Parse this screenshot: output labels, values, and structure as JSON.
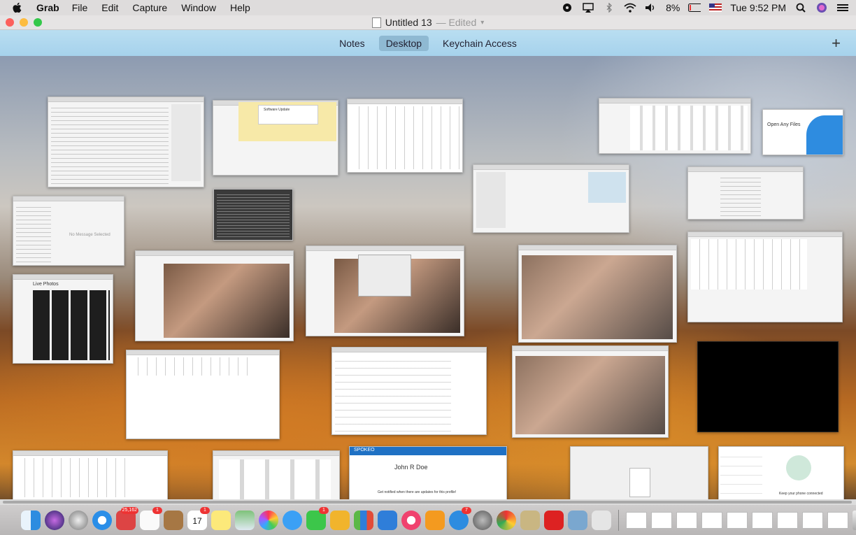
{
  "menubar": {
    "app_name": "Grab",
    "menus": [
      "File",
      "Edit",
      "Capture",
      "Window",
      "Help"
    ],
    "battery": "8%",
    "clock": "Tue 9:52 PM"
  },
  "window": {
    "title": "Untitled 13",
    "status": "— Edited",
    "tabs": [
      "Notes",
      "Desktop",
      "Keychain Access"
    ],
    "active_tab": "Desktop",
    "add_label": "+"
  },
  "thumbnails": {
    "mail_empty": "No Message Selected",
    "photos_title": "Live Photos",
    "open_files": "Open Any Files",
    "profile_name": "John R Doe",
    "profile_notice": "Get notified when there are updates for this profile!",
    "whatsapp_text": "Keep your phone connected",
    "spokeo": "SPOKEO",
    "software_update": "Software Update"
  },
  "dock": {
    "badges": {
      "photos": "25,162",
      "reminders": "1",
      "calendar": "1",
      "calendar_day": "17",
      "facetime": "1",
      "appstore": "7"
    }
  },
  "colors": {
    "tabbar": "#a6d2ec",
    "active_tab": "#8fb9d2",
    "close": "#fc605c",
    "minimize": "#fdbc40",
    "zoom": "#34c84a"
  }
}
